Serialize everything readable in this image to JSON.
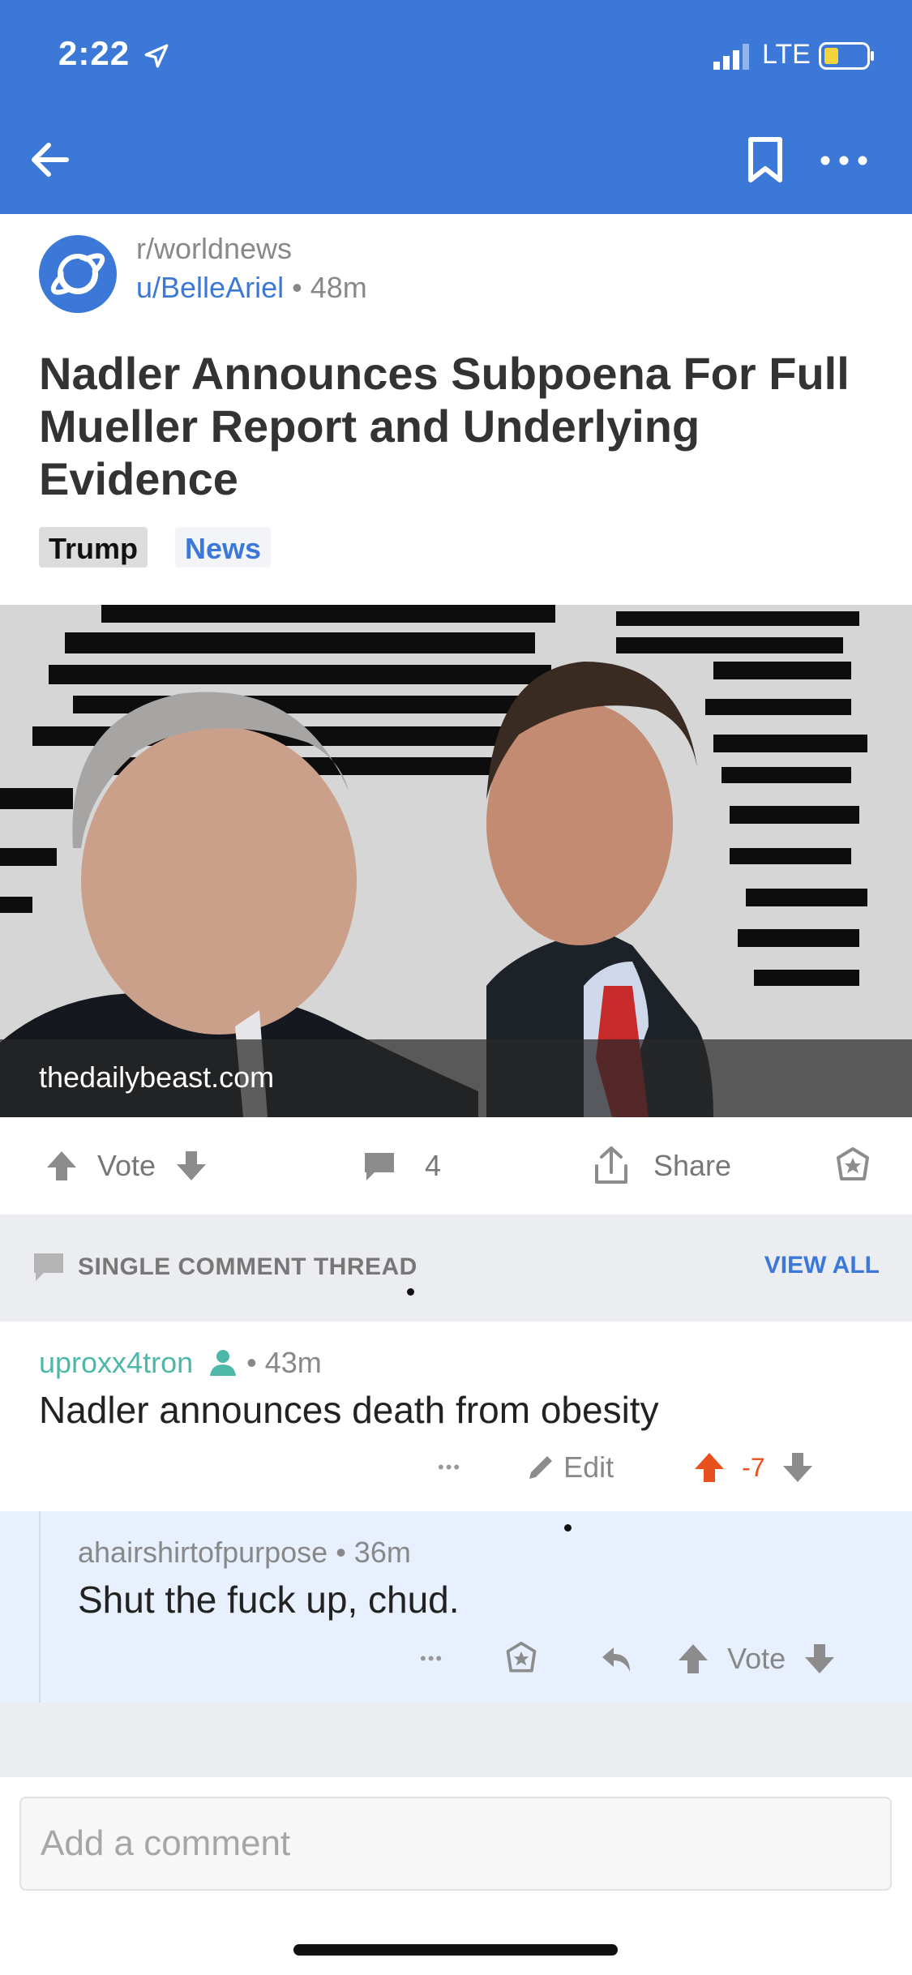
{
  "status_bar": {
    "time": "2:22",
    "network": "LTE"
  },
  "post": {
    "subreddit": "r/worldnews",
    "author": "u/BelleAriel",
    "age": "48m",
    "title": "Nadler Announces Subpoena For Full Mueller Report and Underlying Evidence",
    "flairs": [
      "Trump",
      "News"
    ],
    "link_domain": "thedailybeast.com",
    "vote_label": "Vote",
    "comment_count": "4",
    "share_label": "Share"
  },
  "thread": {
    "label": "SINGLE COMMENT THREAD",
    "view_all": "VIEW ALL"
  },
  "comments": [
    {
      "user": "uproxx4tron",
      "age": "43m",
      "body": "Nadler announces death from obesity",
      "edit_label": "Edit",
      "score": "-7",
      "ellipsis": "•••"
    },
    {
      "user": "ahairshirtofpurpose",
      "age": "36m",
      "body": "Shut the fuck up, chud.",
      "vote_label": "Vote",
      "ellipsis": "•••"
    }
  ],
  "composer": {
    "placeholder": "Add a comment"
  },
  "colors": {
    "brand_blue": "#3c78d8",
    "upvote_orange": "#e8511e",
    "op_teal": "#4db8a8"
  },
  "meta_separator": " • "
}
